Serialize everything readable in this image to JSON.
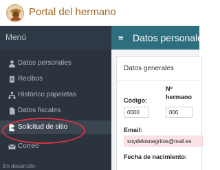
{
  "header": {
    "logo_icon": "brotherhood-emblem-icon",
    "title": "Portal del hermano"
  },
  "sidebar": {
    "menu_title": "Menú",
    "items": [
      {
        "label": "Datos personales",
        "icon": "user-icon"
      },
      {
        "label": "Recibos",
        "icon": "receipt-icon"
      },
      {
        "label": "Histórico papeletas",
        "icon": "sitemap-icon"
      },
      {
        "label": "Datos fiscales",
        "icon": "file-icon"
      },
      {
        "label": "Solicitud de sitio",
        "icon": "file-arrow-icon",
        "active": true
      },
      {
        "label": "Correo",
        "icon": "mail-icon"
      }
    ],
    "section_footer": "En desarrollo"
  },
  "main": {
    "menu_icon": "≡",
    "title": "Datos personales",
    "card_title": "Datos generales",
    "fields": {
      "codigo_label": "Código:",
      "codigo_value": "0000",
      "numero_label_line1": "Nº",
      "numero_label_line2": "hermano",
      "numero_value": "000",
      "email_label": "Email:",
      "email_value": "soydelosnegritos@mail.es",
      "fecha_label": "Fecha de nacimiento:"
    }
  },
  "colors": {
    "sidebar_bg": "#2b333d",
    "header_teal": "#2d6e7f",
    "brand_brown": "#a2661e",
    "highlight_red": "#d9323f",
    "email_field_pink": "#fbe3e6"
  }
}
